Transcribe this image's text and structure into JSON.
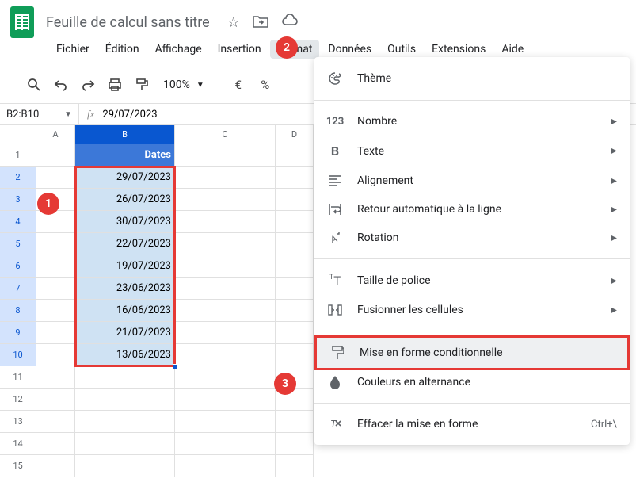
{
  "doc": {
    "title": "Feuille de calcul sans titre"
  },
  "menubar": [
    "Fichier",
    "Édition",
    "Affichage",
    "Insertion",
    "Format",
    "Données",
    "Outils",
    "Extensions",
    "Aide"
  ],
  "toolbar": {
    "zoom": "100%",
    "currency": "€",
    "percent": "%"
  },
  "namebox": "B2:B10",
  "formula": "29/07/2023",
  "columns": [
    "A",
    "B",
    "C",
    "D"
  ],
  "header_label": "Dates",
  "rows": [
    {
      "n": 1,
      "b": ""
    },
    {
      "n": 2,
      "b": "29/07/2023"
    },
    {
      "n": 3,
      "b": "26/07/2023"
    },
    {
      "n": 4,
      "b": "30/07/2023"
    },
    {
      "n": 5,
      "b": "22/07/2023"
    },
    {
      "n": 6,
      "b": "19/07/2023"
    },
    {
      "n": 7,
      "b": "23/06/2023"
    },
    {
      "n": 8,
      "b": "16/06/2023"
    },
    {
      "n": 9,
      "b": "21/07/2023"
    },
    {
      "n": 10,
      "b": "13/06/2023"
    },
    {
      "n": 11,
      "b": ""
    },
    {
      "n": 12,
      "b": ""
    },
    {
      "n": 13,
      "b": ""
    },
    {
      "n": 14,
      "b": ""
    },
    {
      "n": 15,
      "b": ""
    }
  ],
  "dropdown": {
    "theme": "Thème",
    "number": "Nombre",
    "text": "Texte",
    "align": "Alignement",
    "wrap": "Retour automatique à la ligne",
    "rotation": "Rotation",
    "fontsize": "Taille de police",
    "merge": "Fusionner les cellules",
    "conditional": "Mise en forme conditionnelle",
    "alternating": "Couleurs en alternance",
    "clear": "Effacer la mise en forme",
    "clear_shortcut": "Ctrl+\\"
  },
  "badges": {
    "1": "1",
    "2": "2",
    "3": "3"
  }
}
